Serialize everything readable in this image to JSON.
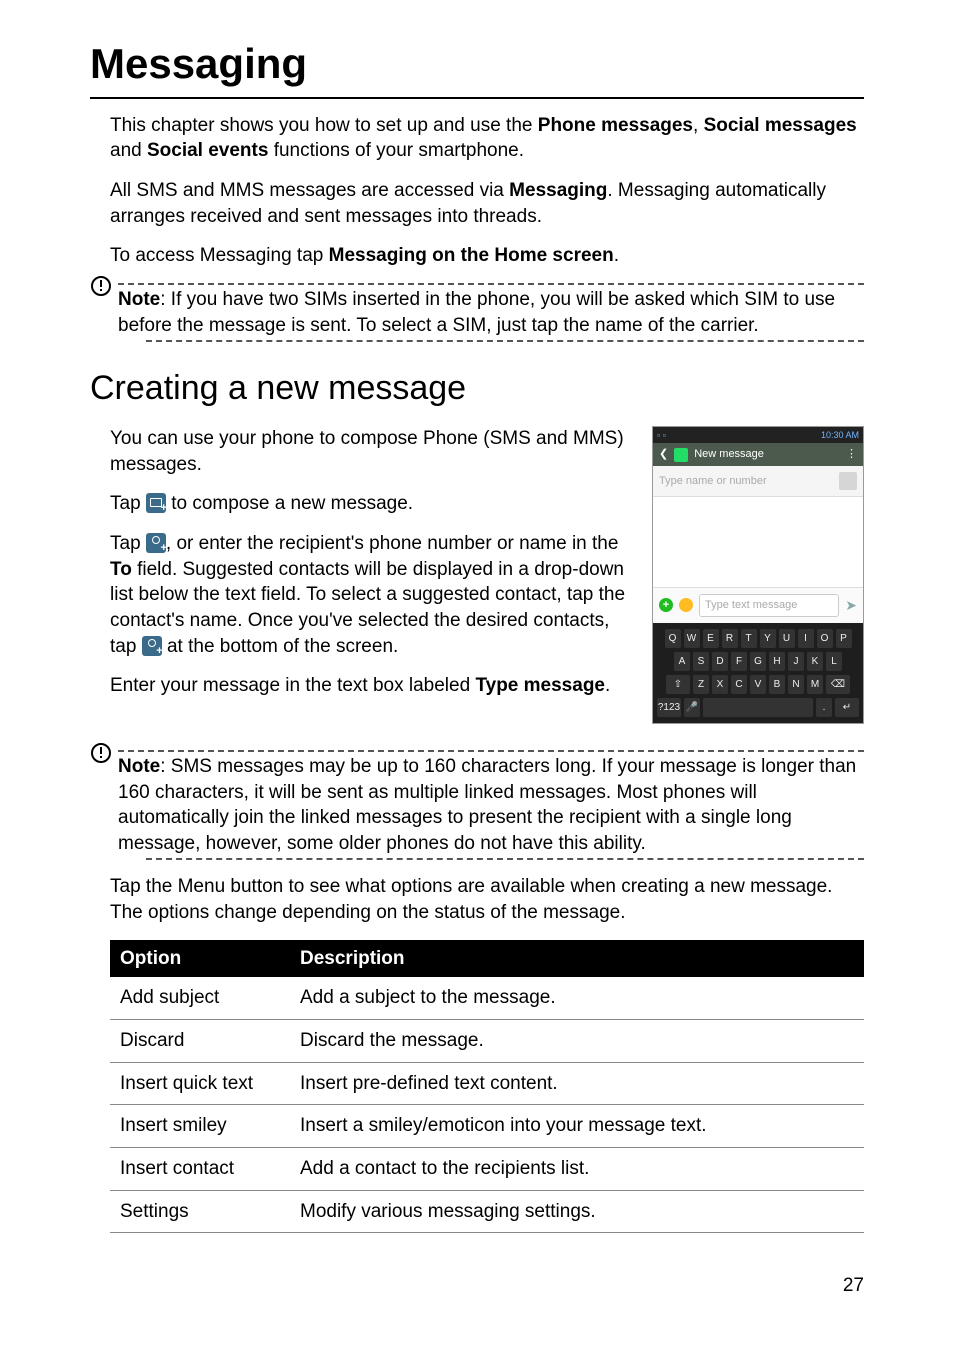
{
  "page_number": "27",
  "title": "Messaging",
  "intro": {
    "p1_a": "This chapter shows you how to set up and use the ",
    "p1_b1": "Phone messages",
    "p1_c": ", ",
    "p1_b2": "Social messages",
    "p1_d": " and ",
    "p1_b3": "Social events",
    "p1_e": " functions of your smartphone.",
    "p2_a": "All SMS and MMS messages are accessed via ",
    "p2_b": "Messaging",
    "p2_c": ". Messaging automatically arranges received and sent messages into threads.",
    "p3_a": "To access Messaging tap ",
    "p3_b": "Messaging on the Home screen",
    "p3_c": "."
  },
  "note1": {
    "label": "Note",
    "text": ": If you have two SIMs inserted in the phone, you will be asked which SIM to use before the message is sent. To select a SIM, just tap the name of the carrier."
  },
  "section1_title": "Creating a new message",
  "section1": {
    "p1": "You can use your phone to compose Phone (SMS and MMS) messages.",
    "p2_a": "Tap ",
    "p2_b": " to compose a new message.",
    "p3_a": "Tap ",
    "p3_b": ", or enter the recipient's phone number or name in the ",
    "p3_bold": "To",
    "p3_c": " field. Suggested contacts will be displayed in a drop-down list below the text field. To select a suggested contact, tap the contact's name. Once you've selected the desired contacts, tap ",
    "p3_d": " at the bottom of the screen.",
    "p4_a": "Enter your message in the text box labeled ",
    "p4_bold": "Type message",
    "p4_c": "."
  },
  "figure": {
    "status_time": "10:30 AM",
    "title": "New message",
    "name_placeholder": "Type name or number",
    "msg_placeholder": "Type text message",
    "kbd_row1": [
      "Q",
      "W",
      "E",
      "R",
      "T",
      "Y",
      "U",
      "I",
      "O",
      "P"
    ],
    "kbd_row2": [
      "A",
      "S",
      "D",
      "F",
      "G",
      "H",
      "J",
      "K",
      "L"
    ],
    "kbd_row3": [
      "⇧",
      "Z",
      "X",
      "C",
      "V",
      "B",
      "N",
      "M",
      "⌫"
    ],
    "kbd_row4": [
      "?123",
      "🎤",
      "",
      ".",
      "↵"
    ]
  },
  "note2": {
    "label": "Note",
    "text": ": SMS messages may be up to 160 characters long. If your message is longer than 160 characters, it will be sent as multiple linked messages. Most phones will automatically join the linked messages to present the recipient with a single long message, however, some older phones do not have this ability."
  },
  "after_note2": "Tap the Menu button to see what options are available when creating a new message. The options change depending on the status of the message.",
  "table": {
    "headers": [
      "Option",
      "Description"
    ],
    "rows": [
      [
        "Add subject",
        "Add a subject to the message."
      ],
      [
        "Discard",
        "Discard the message."
      ],
      [
        "Insert quick text",
        "Insert pre-defined text content."
      ],
      [
        "Insert smiley",
        "Insert a smiley/emoticon into your message text."
      ],
      [
        "Insert contact",
        "Add a contact to the recipients list."
      ],
      [
        "Settings",
        "Modify various messaging settings."
      ]
    ]
  }
}
